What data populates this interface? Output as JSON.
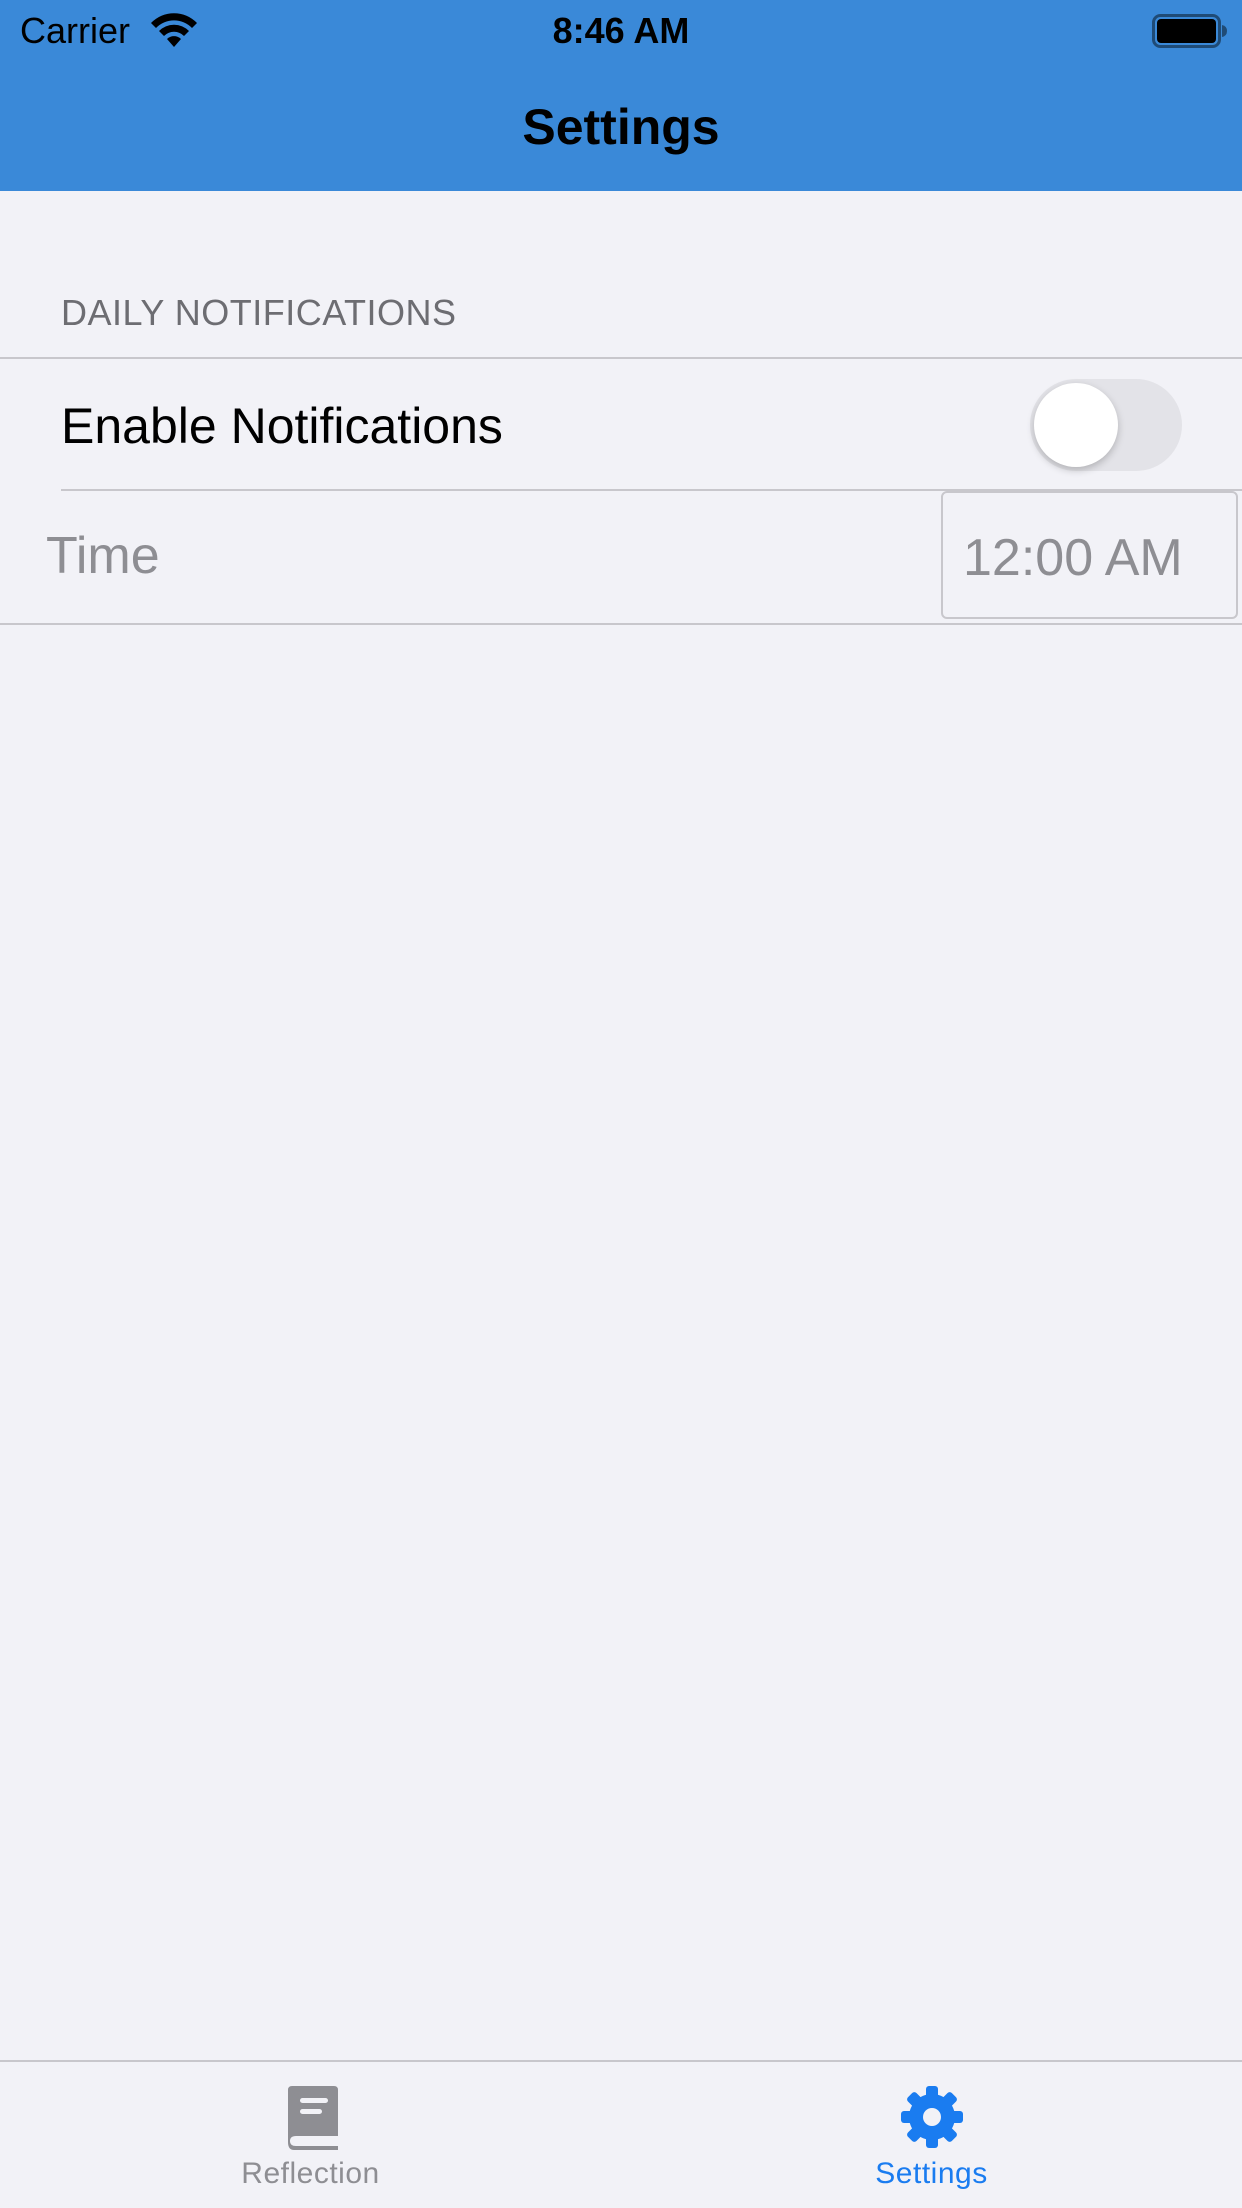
{
  "status_bar": {
    "carrier": "Carrier",
    "time": "8:46 AM",
    "wifi_icon": "wifi-icon",
    "battery_icon": "battery-icon"
  },
  "nav": {
    "title": "Settings"
  },
  "daily_notifications": {
    "section_title": "DAILY NOTIFICATIONS",
    "enable_label": "Enable Notifications",
    "enable_on": false,
    "time_label": "Time",
    "time_value": "12:00 AM"
  },
  "tab_bar": {
    "tabs": [
      {
        "label": "Reflection",
        "icon": "book-icon",
        "selected": false
      },
      {
        "label": "Settings",
        "icon": "gear-icon",
        "selected": true
      }
    ]
  },
  "colors": {
    "header": "#3a89d8",
    "background": "#f2f2f7",
    "tab_active": "#1a7cf0",
    "tab_inactive": "#8e8e93"
  }
}
